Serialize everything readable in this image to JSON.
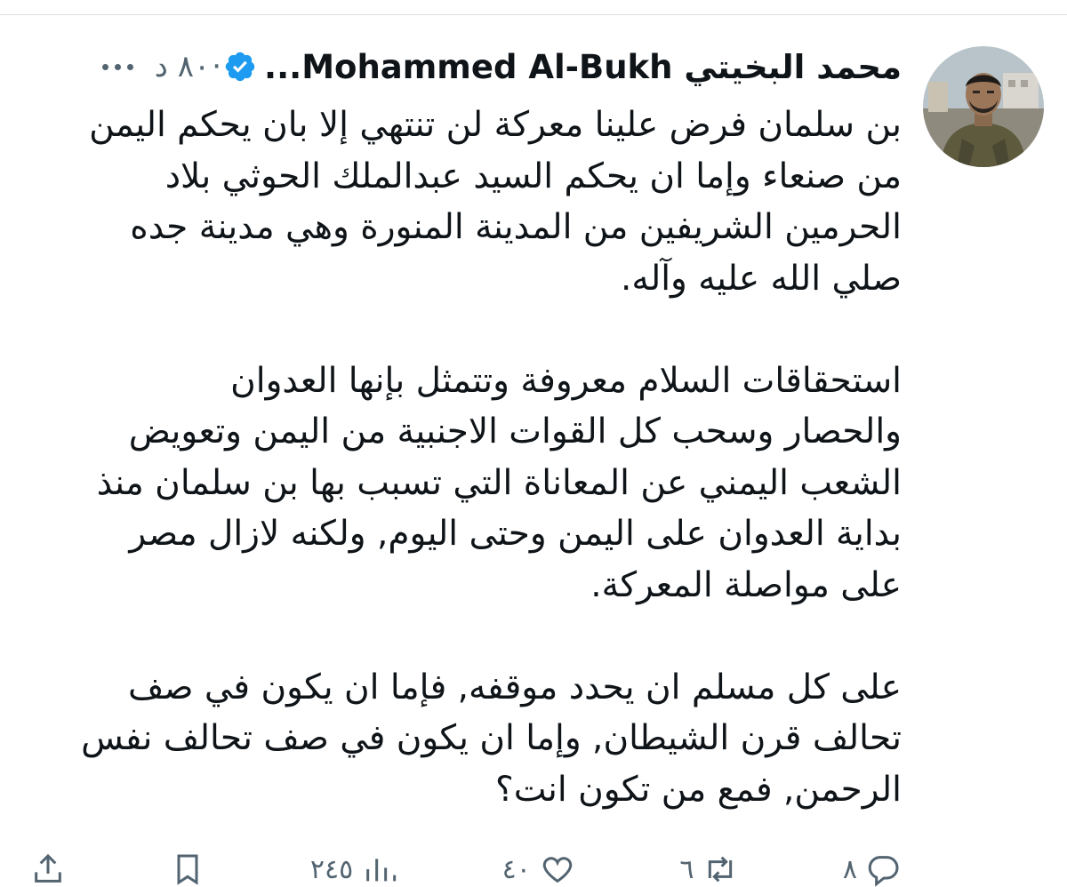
{
  "tweet": {
    "author": {
      "display_name": "محمد البخيتي Mohammed Al-Bukh...",
      "verified": true,
      "avatar": "avatar-photo"
    },
    "timestamp": "٨٠ د",
    "dot": "·",
    "more_icon": "more-horizontal-icon",
    "paragraphs": [
      {
        "lines": [
          "بن سلمان فرض علينا معركة لن تنتهي إلا بان يحكم اليمن",
          "من صنعاء وإما ان يحكم السيد عبدالملك الحوثي بلاد",
          "الحرمين الشريفين من المدينة المنورة وهي مدينة جده",
          "صلي الله عليه وآله."
        ]
      },
      {
        "lines": [
          "استحقاقات السلام معروفة وتتمثل بإنها العدوان",
          "والحصار وسحب كل القوات الاجنبية من اليمن وتعويض",
          "الشعب اليمني عن المعاناة التي تسبب بها بن سلمان منذ",
          "بداية العدوان على اليمن وحتى اليوم, ولكنه لازال مصر",
          "على مواصلة المعركة."
        ]
      },
      {
        "lines": [
          "على كل مسلم ان يحدد موقفه, فإما ان يكون في صف",
          "تحالف قرن الشيطان, وإما ان يكون في صف تحالف نفس",
          "الرحمن, فمع من تكون انت؟"
        ]
      }
    ],
    "actions": {
      "reply": {
        "icon": "reply-icon",
        "count": "٨"
      },
      "retweet": {
        "icon": "retweet-icon",
        "count": "٦"
      },
      "like": {
        "icon": "like-icon",
        "count": "٤٠"
      },
      "views": {
        "icon": "views-icon",
        "count": "٢٤٥"
      },
      "bookmark": {
        "icon": "bookmark-icon"
      },
      "share": {
        "icon": "share-icon"
      }
    },
    "colors": {
      "text": "#0f1419",
      "secondary": "#536471",
      "verified": "#1d9bf0",
      "divider": "#dedede"
    }
  }
}
